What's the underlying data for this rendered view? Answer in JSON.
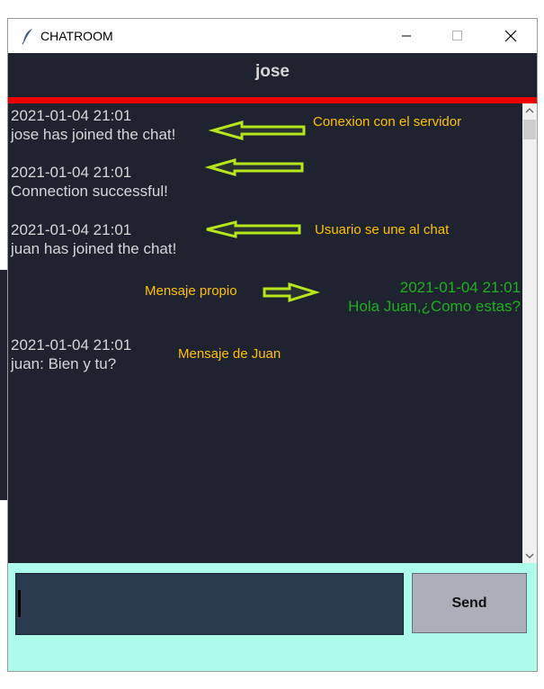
{
  "window": {
    "title": "CHATROOM",
    "icon": "feather-icon"
  },
  "header": {
    "username": "jose"
  },
  "colors": {
    "chat_bg": "#1f2330",
    "header_bg": "#1f2330",
    "accent_line": "#ee0000",
    "own_message": "#1fae1f",
    "annotation": "#ffc000",
    "arrow": "#b8e61c",
    "input_area_bg": "#adfbeb",
    "input_bg": "#2b3a4f",
    "send_bg": "#abb0b8"
  },
  "messages": [
    {
      "timestamp": "2021-01-04 21:01",
      "text": "jose has joined the chat!"
    },
    {
      "timestamp": "2021-01-04 21:01",
      "text": "Connection successful!"
    },
    {
      "timestamp": "2021-01-04 21:01",
      "text": "juan has joined the chat!"
    },
    {
      "timestamp": "2021-01-04 21:01",
      "text": "Hola Juan,¿Como estas?"
    },
    {
      "timestamp": "2021-01-04 21:01",
      "text": "juan: Bien y tu?"
    }
  ],
  "annotations": {
    "server": "Conexion con el servidor",
    "user_join": "Usuario se une al chat",
    "own": "Mensaje propio",
    "juan": "Mensaje de Juan"
  },
  "input": {
    "value": ""
  },
  "send_label": "Send"
}
